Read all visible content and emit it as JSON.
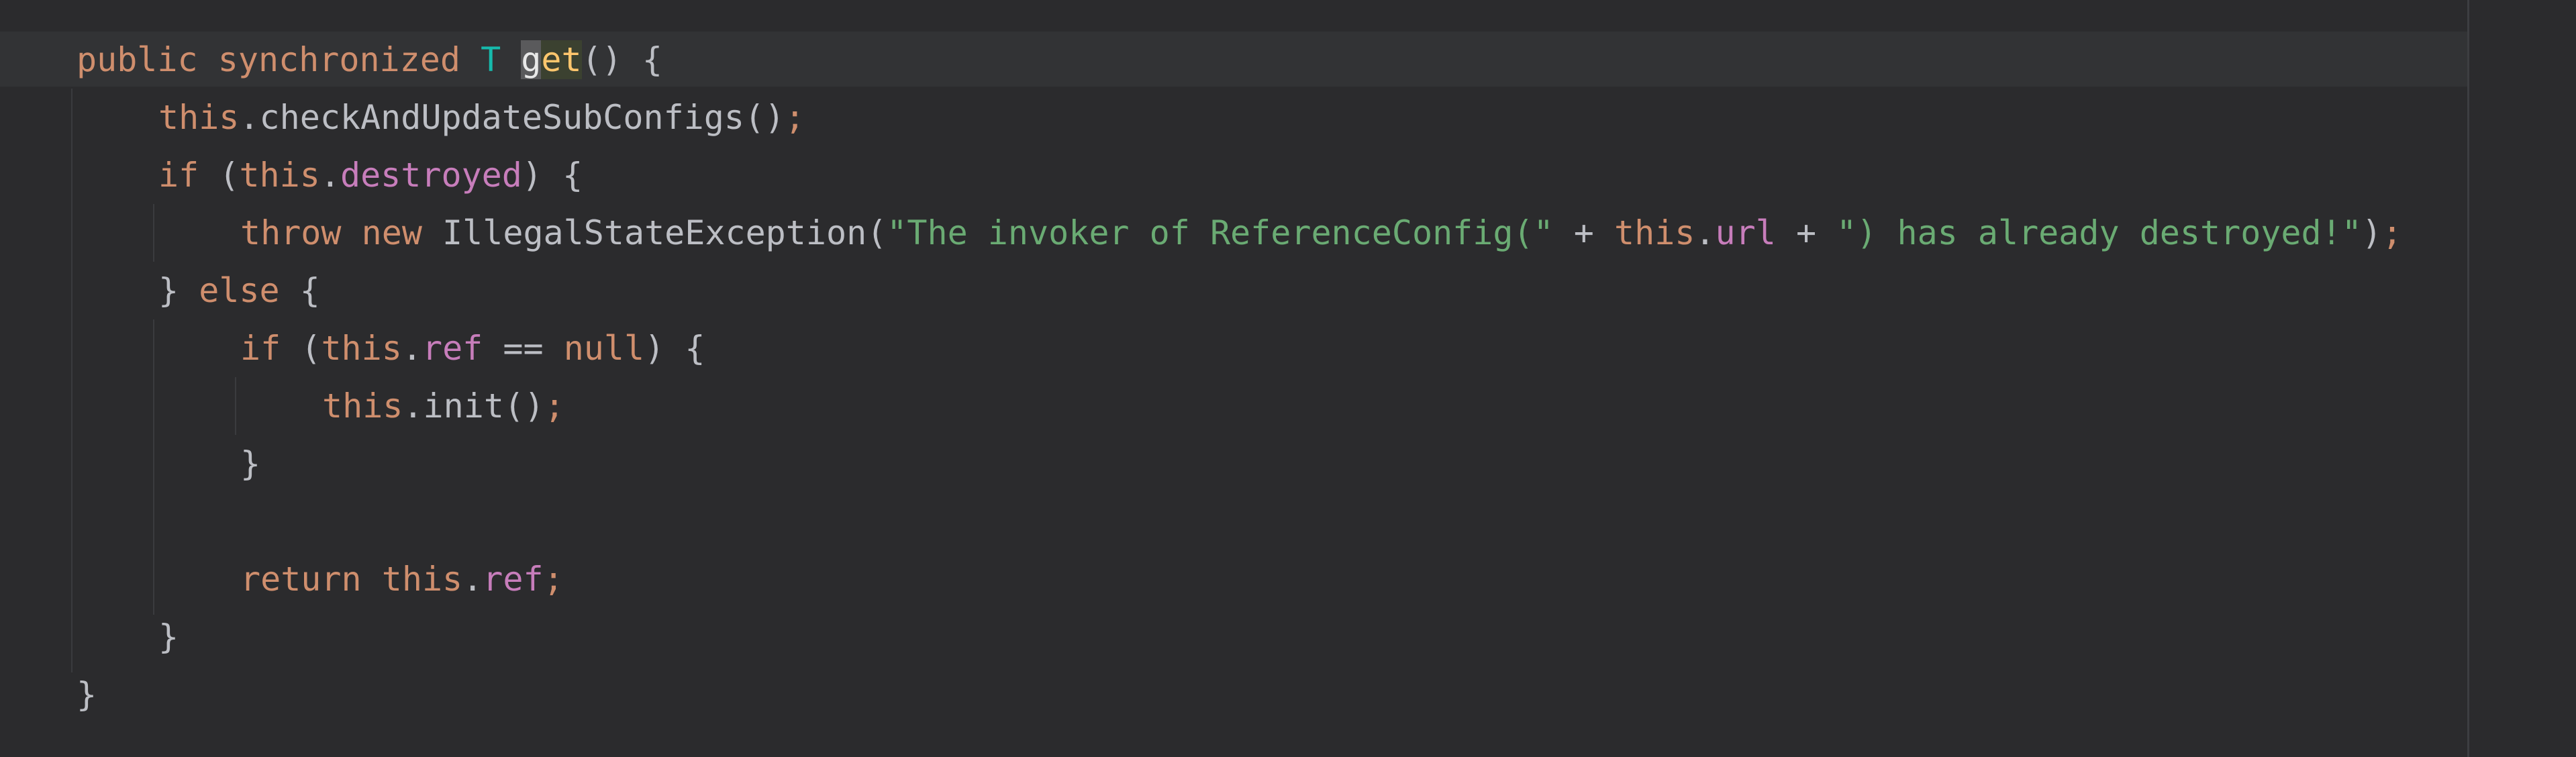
{
  "editor": {
    "lines": [
      {
        "tokens": [
          {
            "t": "public",
            "c": "kw"
          },
          {
            "t": " ",
            "c": "pl"
          },
          {
            "t": "synchronized",
            "c": "kw"
          },
          {
            "t": " ",
            "c": "pl"
          },
          {
            "t": "T",
            "c": "tp"
          },
          {
            "t": " ",
            "c": "pl"
          },
          {
            "t": "g",
            "c": "hl"
          },
          {
            "t": "et",
            "c": "hl2"
          },
          {
            "t": "() {",
            "c": "pl"
          }
        ]
      },
      {
        "tokens": [
          {
            "t": "this",
            "c": "kw"
          },
          {
            "t": ".checkAndUpdateSubConfigs()",
            "c": "pl"
          },
          {
            "t": ";",
            "c": "pu"
          }
        ]
      },
      {
        "tokens": [
          {
            "t": "if",
            "c": "kw"
          },
          {
            "t": " (",
            "c": "pl"
          },
          {
            "t": "this",
            "c": "kw"
          },
          {
            "t": ".",
            "c": "pl"
          },
          {
            "t": "destroyed",
            "c": "fd"
          },
          {
            "t": ") {",
            "c": "pl"
          }
        ]
      },
      {
        "tokens": [
          {
            "t": "throw",
            "c": "kw"
          },
          {
            "t": " ",
            "c": "pl"
          },
          {
            "t": "new",
            "c": "kw"
          },
          {
            "t": " IllegalStateException(",
            "c": "pl"
          },
          {
            "t": "\"The invoker of ReferenceConfig(\"",
            "c": "st"
          },
          {
            "t": " + ",
            "c": "pl"
          },
          {
            "t": "this",
            "c": "kw"
          },
          {
            "t": ".",
            "c": "pl"
          },
          {
            "t": "url",
            "c": "fd"
          },
          {
            "t": " + ",
            "c": "pl"
          },
          {
            "t": "\") has already destroyed!\"",
            "c": "st"
          },
          {
            "t": ")",
            "c": "pl"
          },
          {
            "t": ";",
            "c": "pu"
          }
        ]
      },
      {
        "tokens": [
          {
            "t": "} ",
            "c": "pl"
          },
          {
            "t": "else",
            "c": "kw"
          },
          {
            "t": " {",
            "c": "pl"
          }
        ]
      },
      {
        "tokens": [
          {
            "t": "if",
            "c": "kw"
          },
          {
            "t": " (",
            "c": "pl"
          },
          {
            "t": "this",
            "c": "kw"
          },
          {
            "t": ".",
            "c": "pl"
          },
          {
            "t": "ref",
            "c": "fd"
          },
          {
            "t": " == ",
            "c": "pl"
          },
          {
            "t": "null",
            "c": "kw"
          },
          {
            "t": ") {",
            "c": "pl"
          }
        ]
      },
      {
        "tokens": [
          {
            "t": "this",
            "c": "kw"
          },
          {
            "t": ".init()",
            "c": "pl"
          },
          {
            "t": ";",
            "c": "pu"
          }
        ]
      },
      {
        "tokens": [
          {
            "t": "}",
            "c": "pl"
          }
        ]
      },
      {
        "tokens": []
      },
      {
        "tokens": [
          {
            "t": "return",
            "c": "kw"
          },
          {
            "t": " ",
            "c": "pl"
          },
          {
            "t": "this",
            "c": "kw"
          },
          {
            "t": ".",
            "c": "pl"
          },
          {
            "t": "ref",
            "c": "fd"
          },
          {
            "t": ";",
            "c": "pu"
          }
        ]
      },
      {
        "tokens": [
          {
            "t": "}",
            "c": "pl"
          }
        ]
      },
      {
        "tokens": [
          {
            "t": "}",
            "c": "pl"
          }
        ]
      }
    ]
  }
}
